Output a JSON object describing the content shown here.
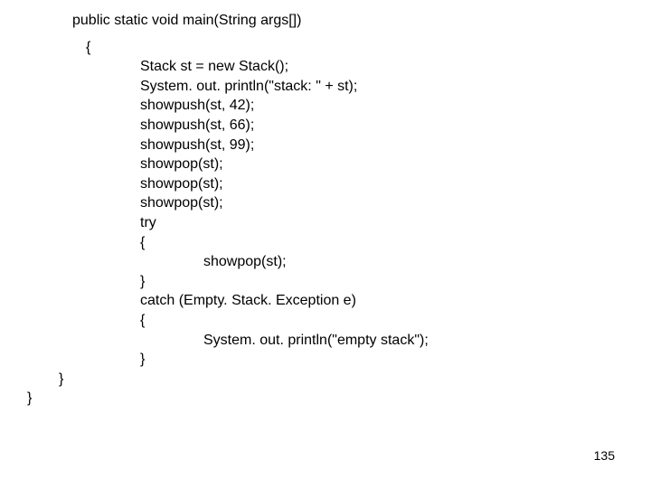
{
  "code": {
    "l01": "public static void main(String args[])",
    "l02": "{",
    "l03": "Stack st = new Stack();",
    "l04": "System. out. println(\"stack: \" + st);",
    "l05": "showpush(st, 42);",
    "l06": "showpush(st, 66);",
    "l07": "showpush(st, 99);",
    "l08": "showpop(st);",
    "l09": "showpop(st);",
    "l10": "showpop(st);",
    "l11": "try",
    "l12": "{",
    "l13": "showpop(st);",
    "l14": "}",
    "l15": "catch (Empty. Stack. Exception e)",
    "l16": "{",
    "l17": "System. out. println(\"empty stack\");",
    "l18": "}",
    "l19": "}",
    "l20": "}"
  },
  "page_number": "135"
}
